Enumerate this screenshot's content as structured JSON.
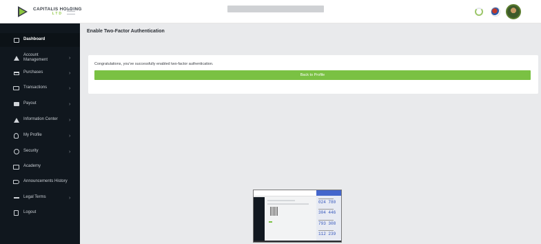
{
  "brand": {
    "name": "CAPITALIS HOLDING",
    "sub": "LTD"
  },
  "colors": {
    "accent": "#7ac143",
    "sidebar": "#10171e",
    "background": "#e9eaec"
  },
  "sidebar": {
    "items": [
      {
        "label": "Dashboard",
        "icon": "dashboard-icon",
        "has_chevron": false,
        "active": true
      },
      {
        "label": "Account Management",
        "icon": "account-icon",
        "has_chevron": true
      },
      {
        "label": "Purchases",
        "icon": "cart-icon",
        "has_chevron": true
      },
      {
        "label": "Transactions",
        "icon": "card-icon",
        "has_chevron": true
      },
      {
        "label": "Payout",
        "icon": "wallet-icon",
        "has_chevron": true
      },
      {
        "label": "Information Center",
        "icon": "info-center-icon",
        "has_chevron": true
      },
      {
        "label": "My Profile",
        "icon": "user-icon",
        "has_chevron": true
      },
      {
        "label": "Security",
        "icon": "key-icon",
        "has_chevron": true
      },
      {
        "label": "Academy",
        "icon": "book-icon",
        "has_chevron": false
      },
      {
        "label": "Announcements History",
        "icon": "megaphone-icon",
        "has_chevron": false
      },
      {
        "label": "Legal Terms",
        "icon": "scale-icon",
        "has_chevron": true
      },
      {
        "label": "Logout",
        "icon": "logout-icon",
        "has_chevron": false
      }
    ]
  },
  "main": {
    "title": "Enable Two-Factor Authentication",
    "message": "Congratulations, you've successfully enabled two-factor authentication.",
    "button_label": "Back to Profile"
  },
  "thumbnail": {
    "codes": [
      "024 780",
      "304 446",
      "793 308",
      "112 239"
    ]
  }
}
